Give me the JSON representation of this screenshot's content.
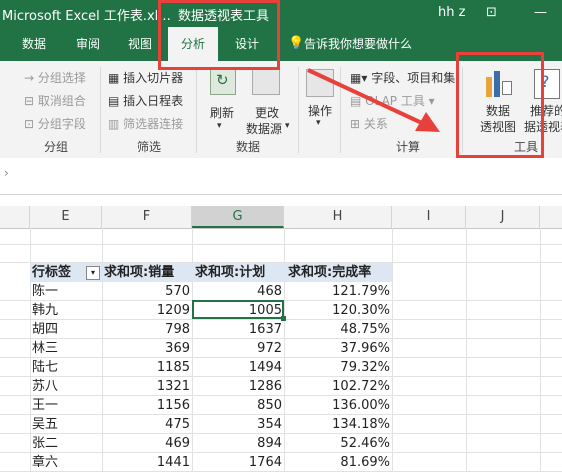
{
  "title_bar": {
    "app_title": "Microsoft Excel 工作表.xl...",
    "context_title": "数据透视表工具",
    "user": "hh z"
  },
  "tabs": [
    {
      "label": "数据"
    },
    {
      "label": "审阅"
    },
    {
      "label": "视图"
    },
    {
      "label": "分析"
    },
    {
      "label": "设计"
    }
  ],
  "tell_me": "告诉我你想要做什么",
  "ribbon": {
    "group1": {
      "items": [
        "分组选择",
        "取消组合",
        "分组字段"
      ],
      "label": "分组"
    },
    "group2": {
      "items": [
        "插入切片器",
        "插入日程表",
        "筛选器连接"
      ],
      "label": "筛选"
    },
    "group3": {
      "refresh": "刷新",
      "change_line1": "更改",
      "change_line2": "数据源",
      "label": "数据"
    },
    "group4": {
      "action": "操作",
      "fields": "字段、项目和集",
      "olap": "OLAP 工具",
      "relations": "关系",
      "label": "计算"
    },
    "group5": {
      "pivot_chart_l1": "数据",
      "pivot_chart_l2": "透视图",
      "recommended_l1": "推荐的数",
      "recommended_l2": "据透视表",
      "label": "工具"
    }
  },
  "columns": [
    "E",
    "F",
    "G",
    "H",
    "I",
    "J"
  ],
  "pivot": {
    "headers": [
      "行标签",
      "求和项:销量",
      "求和项:计划",
      "求和项:完成率"
    ],
    "rows": [
      [
        "陈一",
        "570",
        "468",
        "121.79%"
      ],
      [
        "韩九",
        "1209",
        "1005",
        "120.30%"
      ],
      [
        "胡四",
        "798",
        "1637",
        "48.75%"
      ],
      [
        "林三",
        "369",
        "972",
        "37.96%"
      ],
      [
        "陆七",
        "1185",
        "1494",
        "79.32%"
      ],
      [
        "苏八",
        "1321",
        "1286",
        "102.72%"
      ],
      [
        "王一",
        "1156",
        "850",
        "136.00%"
      ],
      [
        "吴五",
        "475",
        "354",
        "134.18%"
      ],
      [
        "张二",
        "469",
        "894",
        "52.46%"
      ],
      [
        "章六",
        "1441",
        "1764",
        "81.69%"
      ]
    ]
  }
}
